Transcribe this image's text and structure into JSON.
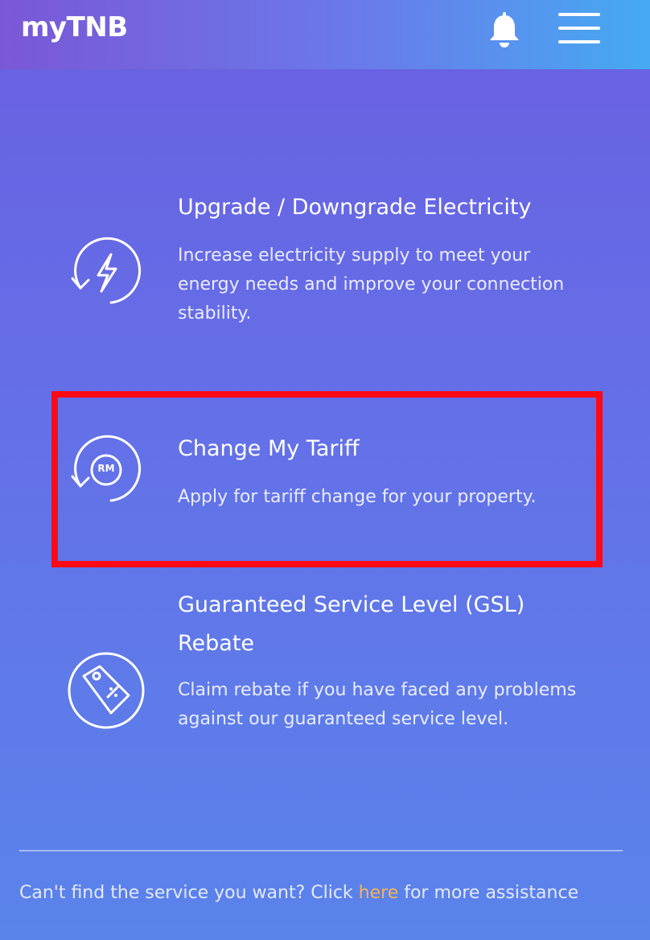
{
  "header": {
    "logo_text_my": "my",
    "logo_text_tnb": "TNB",
    "notification_icon": "bell-icon",
    "menu_icon": "hamburger-menu-icon"
  },
  "services": [
    {
      "title": "Upgrade / Downgrade Electricity",
      "description": "Increase electricity supply to meet your energy needs and improve your connection stability.",
      "icon": "lightning-cycle-icon"
    },
    {
      "title": "Change My Tariff",
      "description": "Apply for tariff change for your property.",
      "icon": "rm-cycle-icon",
      "icon_text": "RM",
      "highlighted": true
    },
    {
      "title": "Guaranteed Service Level (GSL) Rebate",
      "description": "Claim rebate if you have faced any problems against our guaranteed service level.",
      "icon": "discount-tag-icon"
    }
  ],
  "footer": {
    "text_before": "Can't find the service you want? Click ",
    "link_text": "here",
    "text_after": " for more assistance"
  },
  "colors": {
    "highlight_border": "#ff0a14",
    "link": "#f4b35a",
    "header_start": "#7a57d6",
    "header_end": "#45aaf2"
  }
}
